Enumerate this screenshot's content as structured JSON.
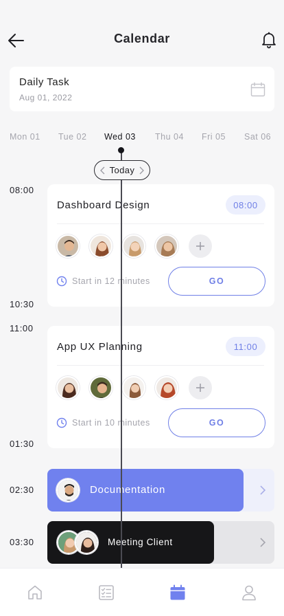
{
  "header": {
    "title": "Calendar"
  },
  "task": {
    "title": "Daily Task",
    "date": "Aug 01, 2022"
  },
  "days": [
    "Mon 01",
    "Tue 02",
    "Wed 03",
    "Thu 04",
    "Fri 05",
    "Sat 06"
  ],
  "active_day": "Wed 03",
  "today_label": "Today",
  "times": [
    "08:00",
    "10:30",
    "11:00",
    "01:30",
    "02:30",
    "03:30"
  ],
  "events": [
    {
      "title": "Dashboard Design",
      "time": "08:00",
      "start_text": "Start in 12 minutes",
      "go_label": "GO",
      "avatars": [
        "avatar-man-1",
        "avatar-woman-1",
        "avatar-woman-2",
        "avatar-woman-3"
      ]
    },
    {
      "title": "App UX Planning",
      "time": "11:00",
      "start_text": "Start in 10 minutes",
      "go_label": "GO",
      "avatars": [
        "avatar-woman-4",
        "avatar-man-2",
        "avatar-woman-5",
        "avatar-woman-6"
      ]
    }
  ],
  "bars": [
    {
      "title": "Documentation"
    },
    {
      "title": "Meeting Client"
    }
  ],
  "colors": {
    "accent": "#7081ee",
    "badge_bg": "#eceffd",
    "dark_bar": "#161618"
  },
  "nav": [
    "home-icon",
    "tasks-icon",
    "calendar-icon",
    "profile-icon"
  ]
}
